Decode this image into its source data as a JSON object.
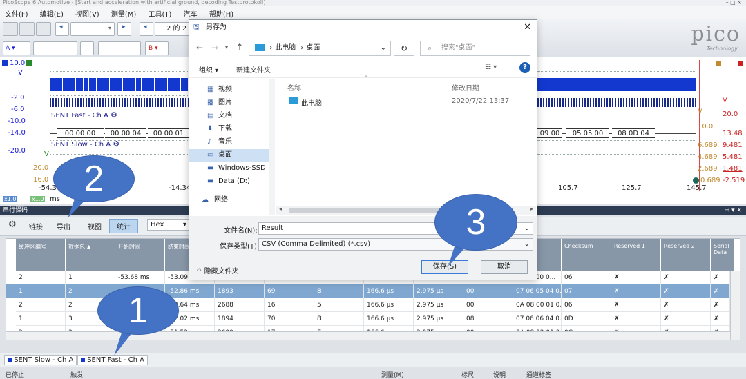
{
  "window": {
    "title": "PicoScope 6 Automotive - [Start and acceleration with artificial ground, decoding Testprotokoll]",
    "controls": "– □ ×"
  },
  "menu": [
    "文件(F)",
    "编辑(E)",
    "视图(V)",
    "测量(M)",
    "工具(T)",
    "汽车",
    "帮助(H)"
  ],
  "toolbar": {
    "page_counter": "2 的 2",
    "channel_a": "A",
    "channel_b": "B"
  },
  "brand": {
    "logo": "pico",
    "sub": "Technology"
  },
  "scope": {
    "y_left": [
      "10.0",
      "V",
      "-2.0",
      "-6.0",
      "-10.0",
      "-14.0",
      "-20.0",
      "V",
      "20.0",
      "16.0"
    ],
    "y_right_red": [
      "V",
      "20.0",
      "13.48",
      "9.481",
      "5.481",
      "1.481",
      "-2.519"
    ],
    "y_right_orange": [
      "V",
      "10.0",
      "6.689",
      "4.689",
      "2.689",
      "0.689"
    ],
    "signals": {
      "fast": "SENT Fast - Ch A",
      "slow": "SENT Slow - Ch A"
    },
    "bus_left": [
      "00 00 00",
      "00 00 04",
      "00 00 01"
    ],
    "bus_right": [
      "09 00",
      "05 05 00",
      "08 0D 04"
    ],
    "x_axis": [
      "-54.3",
      "-14.34",
      "105.7",
      "125.7",
      "145.7"
    ],
    "x_unit": "ms",
    "scale_tags": [
      "x1.0",
      "x1.0"
    ]
  },
  "decode": {
    "panel_title": "串行译码",
    "toolbar": {
      "link": "链接",
      "export": "导出",
      "view": "视图",
      "stats": "统计",
      "format": "Hex"
    },
    "columns_left": [
      "缓冲区编号",
      "数据包 ▲",
      "开始时间",
      "结束时间"
    ],
    "columns_right": [
      "Checksum",
      "Reserved 1",
      "Reserved 2",
      "Serial Data"
    ],
    "rows": [
      [
        "2",
        "1",
        "-53.68 ms",
        "-53.09 ms",
        "",
        "",
        "",
        "",
        "",
        "",
        "07 06 00 0...",
        "06",
        "✗",
        "✗",
        "✗"
      ],
      [
        "1",
        "2",
        "",
        "-52.86 ms",
        "1893",
        "69",
        "8",
        "166.6 µs",
        "2.975 µs",
        "00",
        "07 06 05 04 0...",
        "07",
        "✗",
        "✗",
        "✗"
      ],
      [
        "2",
        "2",
        "",
        "-52.64 ms",
        "2688",
        "16",
        "5",
        "166.6 µs",
        "2.975 µs",
        "00",
        "0A 08 00 01 0...",
        "06",
        "✗",
        "✗",
        "✗"
      ],
      [
        "1",
        "3",
        "",
        "-52.02 ms",
        "1894",
        "70",
        "8",
        "166.6 µs",
        "2.975 µs",
        "08",
        "07 06 06 04 0...",
        "0D",
        "✗",
        "✗",
        "✗"
      ],
      [
        "2",
        "3",
        "",
        "-51.52 ms",
        "2690",
        "17",
        "5",
        "166.6 µs",
        "2.975 µs",
        "00",
        "0A 08 02 01 0...",
        "0C",
        "✗",
        "✗",
        "✗"
      ]
    ],
    "tabs": [
      "SENT Slow - Ch A",
      "SENT Fast - Ch A"
    ]
  },
  "status": {
    "stopped": "已停止",
    "trigger": "触发",
    "measure": "测量(M)",
    "ruler": "标尺",
    "notes": "说明",
    "channel_labels": "通道标签"
  },
  "dialog": {
    "title": "另存为",
    "address": [
      "此电脑",
      "桌面"
    ],
    "search_placeholder": "搜索\"桌面\"",
    "organize": "组织 ▾",
    "new_folder": "新建文件夹",
    "nav": [
      "视频",
      "图片",
      "文档",
      "下载",
      "音乐",
      "桌面",
      "Windows-SSD",
      "Data (D:)",
      "网络"
    ],
    "col_name": "名称",
    "col_date": "修改日期",
    "files": [
      {
        "name": "此电脑",
        "date": "2020/7/22 13:37"
      }
    ],
    "filename_label": "文件名(N):",
    "filename_value": "Result",
    "filetype_label": "保存类型(T):",
    "filetype_value": "CSV (Comma Delimited) (*.csv)",
    "hide_folders": "隐藏文件夹",
    "save": "保存(S)",
    "cancel": "取消"
  },
  "callouts": [
    "1",
    "2",
    "3"
  ],
  "colors": {
    "accent_blue": "#1238d0",
    "callout": "#4472c4",
    "selected_row": "#7fa7d0",
    "panel_header": "#2d3c52"
  }
}
